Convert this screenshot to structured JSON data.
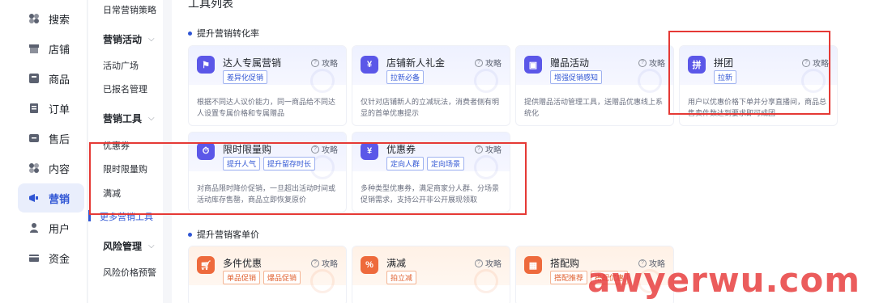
{
  "nav": {
    "items": [
      {
        "label": "搜索",
        "icon": "search-icon"
      },
      {
        "label": "店铺",
        "icon": "shop-icon"
      },
      {
        "label": "商品",
        "icon": "product-icon"
      },
      {
        "label": "订单",
        "icon": "order-icon"
      },
      {
        "label": "售后",
        "icon": "aftersale-icon"
      },
      {
        "label": "内容",
        "icon": "content-icon"
      },
      {
        "label": "营销",
        "icon": "marketing-icon"
      },
      {
        "label": "用户",
        "icon": "user-icon"
      },
      {
        "label": "资金",
        "icon": "wallet-icon"
      }
    ],
    "active": "营销"
  },
  "sub": {
    "daily_strategy": "日常营销策略",
    "group_activity": "营销活动",
    "activity_square": "活动广场",
    "registered": "已报名管理",
    "group_tools": "营销工具",
    "coupon": "优惠券",
    "flash_sale": "限时限量购",
    "full_reduce": "满减",
    "more_tools": "更多营销工具",
    "group_risk": "风险管理",
    "risk_price": "风险价格预警"
  },
  "main": {
    "page_title": "工具列表",
    "section1": "提升营销转化率",
    "section2": "提升营销客单价",
    "help_label": "攻略",
    "cards_row1": [
      {
        "title": "达人专属营销",
        "tags": [
          "差异化促销"
        ],
        "desc": "根据不同达人议价能力，同一商品给不同达人设置专属价格和专属赠品",
        "icon": "flag-icon"
      },
      {
        "title": "店铺新人礼金",
        "tags": [
          "拉新必备"
        ],
        "desc": "仅针对店铺新人的立减玩法，消费者侧有明显的首单优惠提示",
        "icon": "gift-money-icon"
      },
      {
        "title": "赠品活动",
        "tags": [
          "增强促销感知"
        ],
        "desc": "提供赠品活动管理工具，送赠品优惠线上系统化",
        "icon": "gift-icon"
      },
      {
        "title": "拼团",
        "tags": [
          "拉新"
        ],
        "desc": "用户以优惠价格下单并分享直播间，商品总售卖件数达到要求即可成团",
        "icon": "group-buy-icon"
      }
    ],
    "cards_row2": [
      {
        "title": "限时限量购",
        "tags": [
          "提升人气",
          "提升留存时长"
        ],
        "desc": "对商品限时降价促销，一旦超出活动时间或活动库存售罄，商品立即恢复原价",
        "icon": "timer-cart-icon"
      },
      {
        "title": "优惠券",
        "tags": [
          "定向人群",
          "定向场景"
        ],
        "desc": "多种类型优惠券，满足商家分人群、分场景促销需求，支持公开非公开展现领取",
        "icon": "coupon-icon"
      }
    ],
    "cards_row3": [
      {
        "title": "多件优惠",
        "tags": [
          "单品促销",
          "爆品促销"
        ],
        "icon": "cart-icon"
      },
      {
        "title": "满减",
        "tags": [
          "拍立减"
        ],
        "icon": "discount-tag-icon"
      },
      {
        "title": "搭配购",
        "tags": [
          "搭配推荐",
          "搭配优惠"
        ],
        "icon": "bundle-icon"
      }
    ]
  },
  "watermark": "awyerwu.com"
}
